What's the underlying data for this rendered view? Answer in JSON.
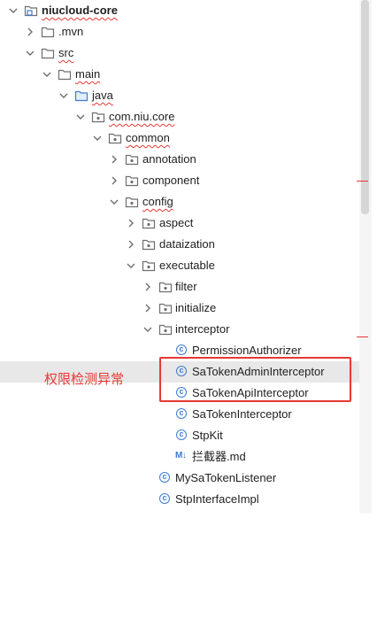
{
  "tree": {
    "items": [
      {
        "label": "niucloud-core",
        "kind": "module",
        "expanded": true
      },
      {
        "label": ".mvn",
        "kind": "folder",
        "expanded": false
      },
      {
        "label": "src",
        "kind": "folder",
        "expanded": true
      },
      {
        "label": "main",
        "kind": "folder",
        "expanded": true
      },
      {
        "label": "java",
        "kind": "source-folder",
        "expanded": true
      },
      {
        "label": "com.niu.core",
        "kind": "package",
        "expanded": true
      },
      {
        "label": "common",
        "kind": "package",
        "expanded": true
      },
      {
        "label": "annotation",
        "kind": "package",
        "expanded": false
      },
      {
        "label": "component",
        "kind": "package",
        "expanded": false
      },
      {
        "label": "config",
        "kind": "package",
        "expanded": true
      },
      {
        "label": "aspect",
        "kind": "package",
        "expanded": false
      },
      {
        "label": "dataization",
        "kind": "package",
        "expanded": false
      },
      {
        "label": "executable",
        "kind": "package",
        "expanded": true
      },
      {
        "label": "filter",
        "kind": "package",
        "expanded": false
      },
      {
        "label": "initialize",
        "kind": "package",
        "expanded": false
      },
      {
        "label": "interceptor",
        "kind": "package",
        "expanded": true
      },
      {
        "label": "PermissionAuthorizer",
        "kind": "class"
      },
      {
        "label": "SaTokenAdminInterceptor",
        "kind": "class"
      },
      {
        "label": "SaTokenApiInterceptor",
        "kind": "class"
      },
      {
        "label": "SaTokenInterceptor",
        "kind": "class"
      },
      {
        "label": "StpKit",
        "kind": "class"
      },
      {
        "label": "拦截器.md",
        "kind": "markdown"
      },
      {
        "label": "MySaTokenListener",
        "kind": "class"
      },
      {
        "label": "StpInterfaceImpl",
        "kind": "class"
      }
    ]
  },
  "annotation": {
    "text": "权限检测异常",
    "color": "#e53935"
  },
  "colors": {
    "class_icon": "#3d7bd6",
    "folder_icon": "#6e6e6e",
    "source_folder_icon": "#3d7bd6",
    "selection": "#e8e8e8"
  }
}
